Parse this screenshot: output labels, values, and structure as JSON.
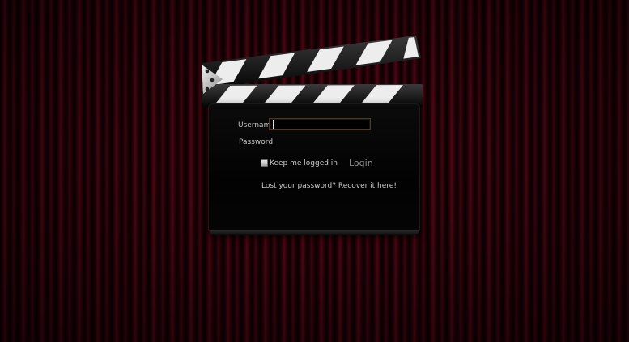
{
  "login_form": {
    "username_label": "Username",
    "username_value": "",
    "password_label": "Password",
    "password_value": "",
    "keep_logged_in_label": "Keep me logged in",
    "keep_logged_in_checked": false,
    "login_label": "Login",
    "recover_link_text": "Lost your password? Recover it here!"
  },
  "icons": {
    "clapperboard": "clapperboard-icon"
  },
  "colors": {
    "curtain": "#3a0610",
    "board": "#050505",
    "label_text": "#c9c9c9",
    "login_text": "#8f8f8f"
  }
}
